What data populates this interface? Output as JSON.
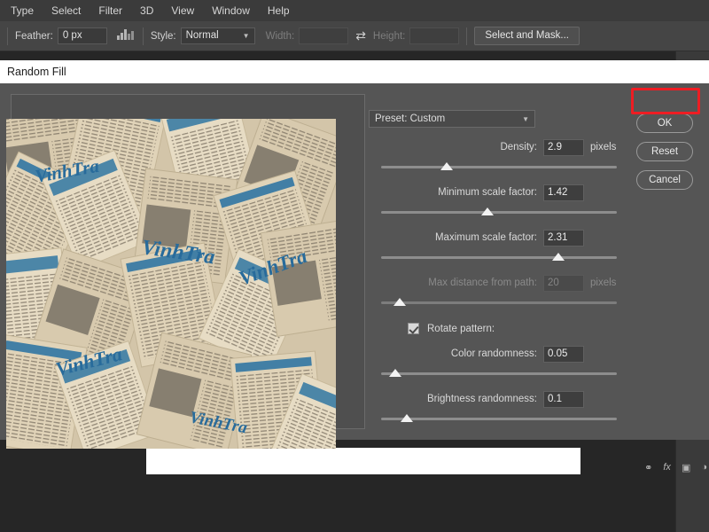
{
  "menubar": {
    "items": [
      {
        "label": "Type"
      },
      {
        "label": "Select"
      },
      {
        "label": "Filter"
      },
      {
        "label": "3D"
      },
      {
        "label": "View"
      },
      {
        "label": "Window"
      },
      {
        "label": "Help"
      }
    ]
  },
  "options_bar": {
    "feather_label": "Feather:",
    "feather_value": "0 px",
    "refine_icon": "histogram-icon",
    "style_label": "Style:",
    "style_value": "Normal",
    "width_label": "Width:",
    "width_value": "",
    "swap_icon": "swap-arrows-icon",
    "height_label": "Height:",
    "height_value": "",
    "select_and_mask_label": "Select and Mask..."
  },
  "dialog": {
    "title": "Random Fill",
    "preset": {
      "label": "Preset: Custom",
      "chevron_icon": "chevron-down-icon"
    },
    "controls": [
      {
        "name": "density",
        "label": "Density:",
        "value": "2.9",
        "unit": "pixels",
        "slider_percent": 28,
        "disabled": false
      },
      {
        "name": "minimum-scale-factor",
        "label": "Minimum scale factor:",
        "value": "1.42",
        "unit": "",
        "slider_percent": 45,
        "disabled": false
      },
      {
        "name": "maximum-scale-factor",
        "label": "Maximum scale factor:",
        "value": "2.31",
        "unit": "",
        "slider_percent": 75,
        "disabled": false
      },
      {
        "name": "max-distance-from-path",
        "label": "Max distance from path:",
        "value": "20",
        "unit": "pixels",
        "slider_percent": 8,
        "disabled": true
      }
    ],
    "rotate_pattern": {
      "label": "Rotate pattern:",
      "checked": true
    },
    "controls_after": [
      {
        "name": "color-randomness",
        "label": "Color randomness:",
        "value": "0.05",
        "unit": "",
        "slider_percent": 6,
        "disabled": false
      },
      {
        "name": "brightness-randomness",
        "label": "Brightness randomness:",
        "value": "0.1",
        "unit": "",
        "slider_percent": 11,
        "disabled": false
      }
    ],
    "buttons": {
      "ok": "OK",
      "reset": "Reset",
      "cancel": "Cancel"
    },
    "annotation": {
      "target": "ok-button",
      "color": "#ee1d23"
    }
  },
  "preview": {
    "description": "Scattered vintage newspaper clippings collage",
    "masthead_text": "VinhTra",
    "paper_color": "#e4d9bf",
    "ink_color": "#1a6fa8"
  },
  "panel_icons": [
    {
      "name": "link-icon",
      "glyph": "⚭"
    },
    {
      "name": "fx-icon",
      "glyph": "fx"
    },
    {
      "name": "layer-mask-icon",
      "glyph": "▣"
    },
    {
      "name": "adjustment-icon",
      "glyph": "◑"
    }
  ]
}
